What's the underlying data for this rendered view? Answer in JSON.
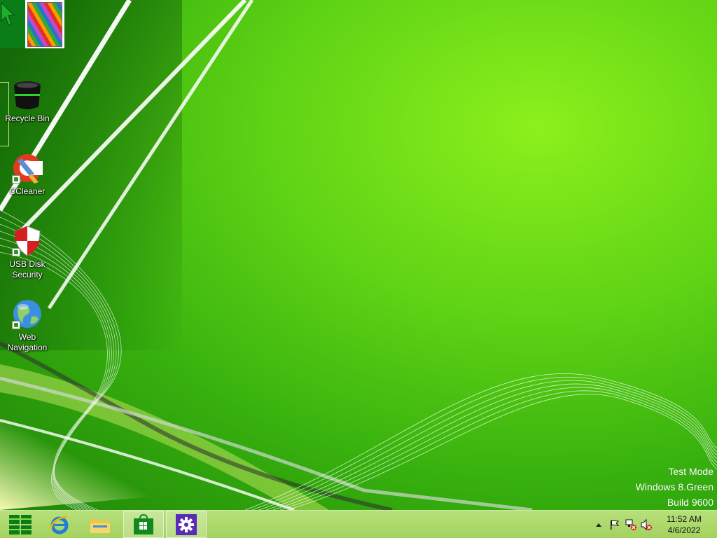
{
  "desktop": {
    "icons": [
      {
        "label": "Recycle Bin",
        "icon": "recycle-bin-icon"
      },
      {
        "label": "CCleaner",
        "icon": "ccleaner-icon"
      },
      {
        "label": "USB Disk Security",
        "icon": "usb-disk-security-icon"
      },
      {
        "label": "Web Navigation",
        "icon": "web-navigation-icon"
      }
    ],
    "watermark": {
      "line1": "Test Mode",
      "line2": "Windows 8.Green",
      "line3": "Build 9600"
    }
  },
  "taskbar": {
    "buttons": [
      {
        "name": "start-button",
        "icon": "windows-logo-icon"
      },
      {
        "name": "internet-explorer-button",
        "icon": "internet-explorer-icon"
      },
      {
        "name": "file-explorer-button",
        "icon": "folder-icon"
      },
      {
        "name": "store-button",
        "icon": "store-icon"
      },
      {
        "name": "settings-button",
        "icon": "gear-icon"
      }
    ],
    "tray": {
      "show_hidden_icon": "up-arrow-icon",
      "action_center_icon": "flag-icon",
      "network_icon": "network-disconnected-icon",
      "volume_icon": "speaker-muted-icon",
      "time": "11:52 AM",
      "date": "4/6/2022"
    }
  },
  "colors": {
    "accent": "#6fd91a",
    "taskbar": "#a8d564"
  }
}
